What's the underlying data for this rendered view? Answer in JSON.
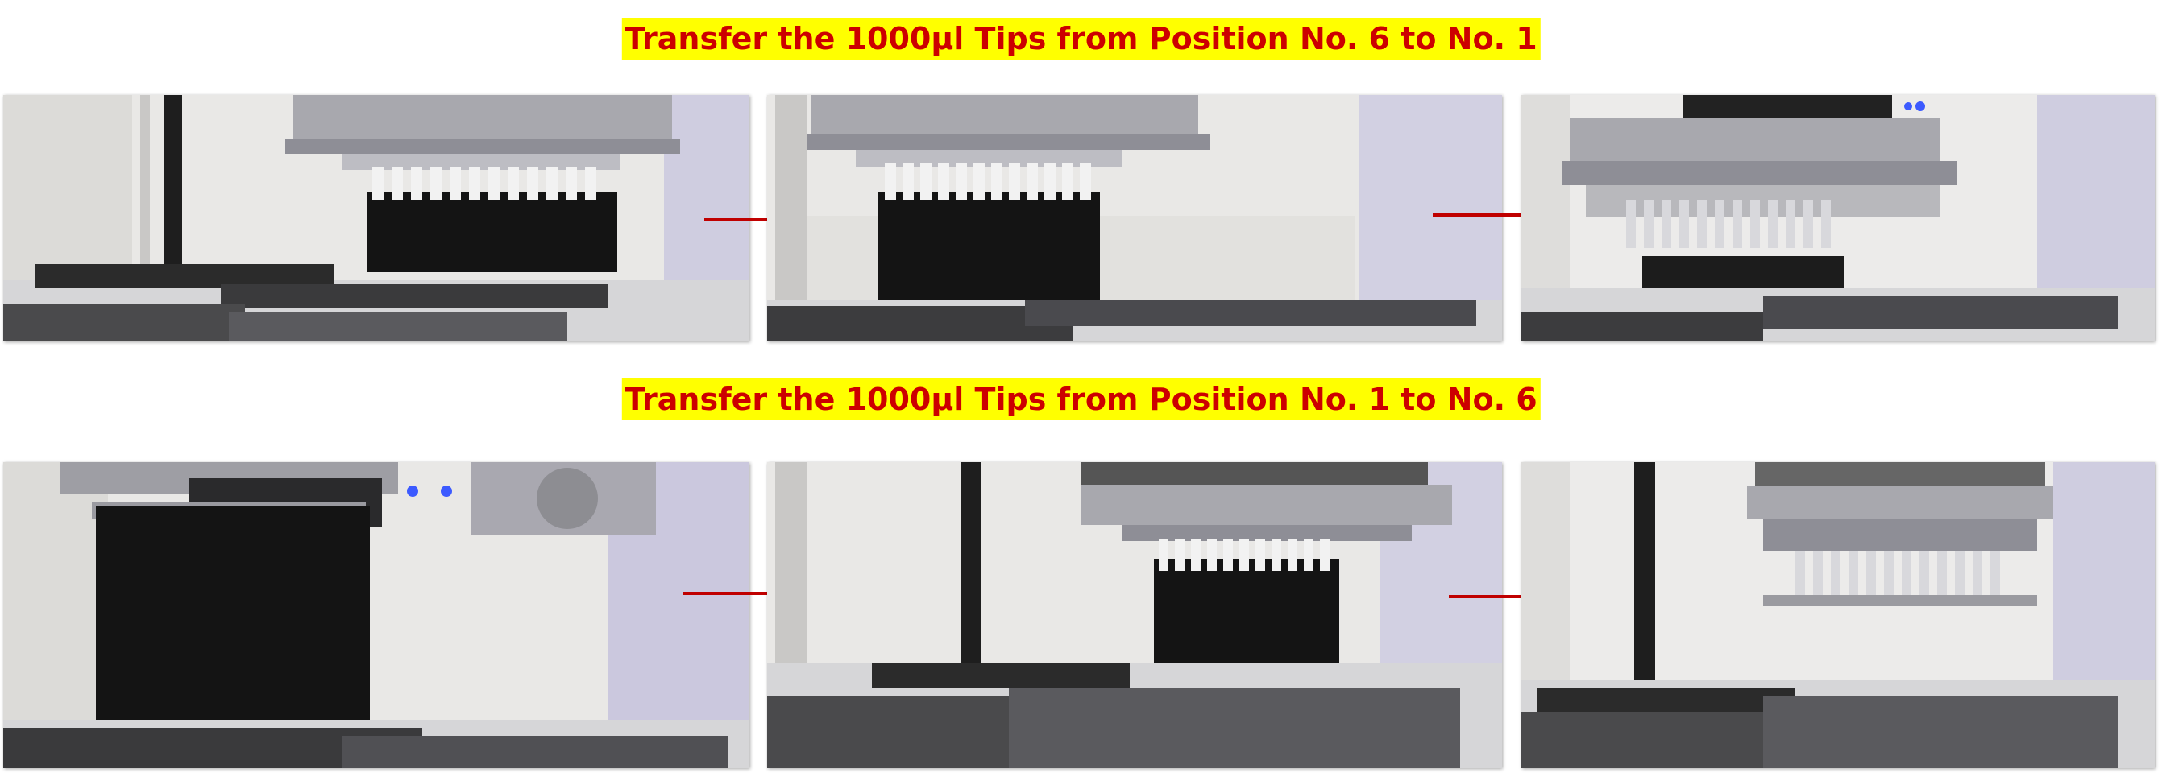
{
  "titles": {
    "top": "Transfer the 1000µl Tips from Position No. 6 to No. 1",
    "bottom": "Transfer the 1000µl Tips from Position No. 1 to No. 6"
  },
  "colors": {
    "title_text": "#cc0000",
    "title_highlight": "#ffff00",
    "arrow": "#c00000",
    "tips": "#141414",
    "head": "#a8a8ae",
    "deck": "#d8d8da",
    "wall": "#ecebea",
    "column_purple": "#b4afd2"
  },
  "photos": {
    "top": [
      "tip-head-lowered-over-rack",
      "tip-head-holding-tips-close-up",
      "tip-head-lifted-above-rack"
    ],
    "bottom": [
      "tips-lifted-on-head-over-deck",
      "tip-head-lowering-tips-onto-rack",
      "empty-tip-head-lifted"
    ]
  }
}
